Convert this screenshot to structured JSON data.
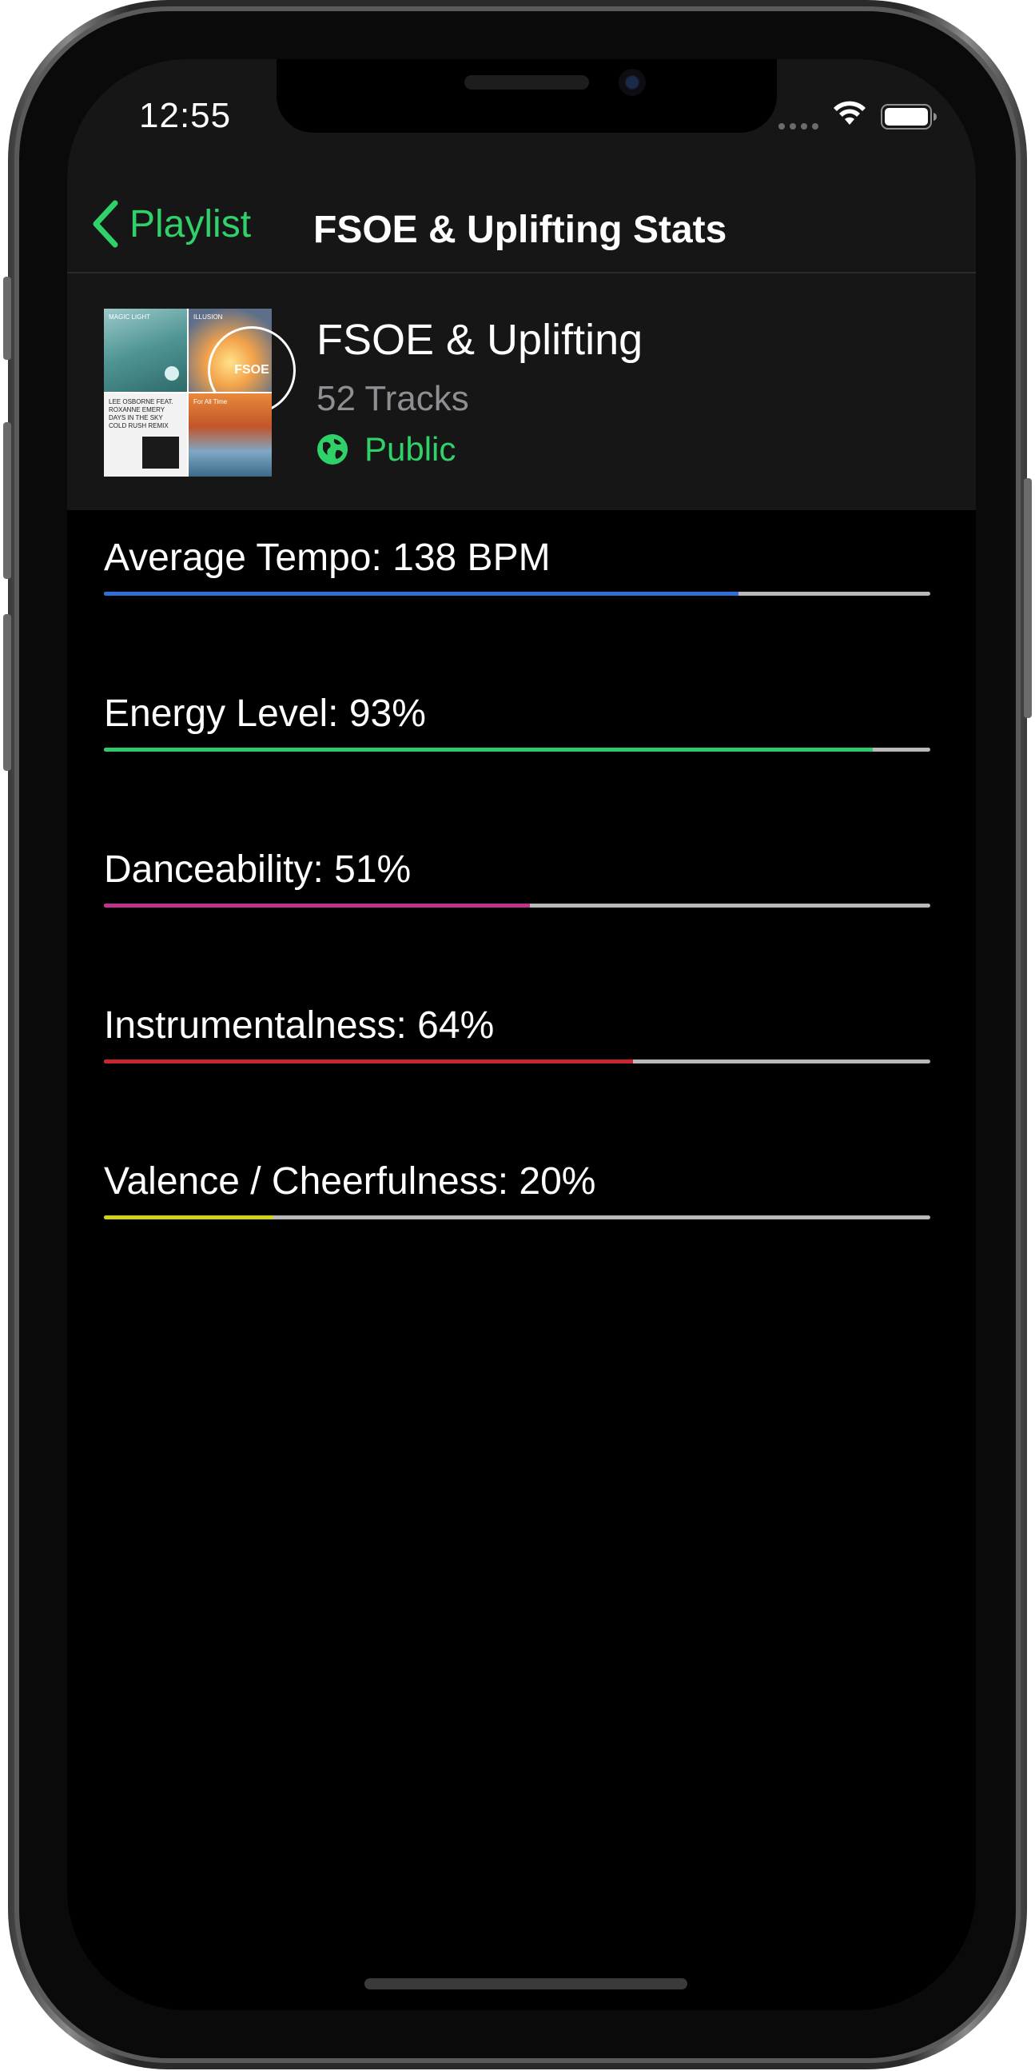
{
  "status_bar": {
    "time": "12:55"
  },
  "nav": {
    "back_label": "Playlist",
    "title": "FSOE & Uplifting Stats"
  },
  "playlist": {
    "name": "FSOE & Uplifting",
    "track_count": "52 Tracks",
    "visibility": "Public",
    "artwork": [
      {
        "label": "MAGIC LIGHT"
      },
      {
        "label": "ILLUSION"
      },
      {
        "label": "LEE OSBORNE FEAT. ROXANNE EMERY\nDAYS IN THE SKY\nCOLD RUSH REMIX"
      },
      {
        "label": "For All Time"
      }
    ]
  },
  "stats": [
    {
      "label": "Average Tempo: 138 BPM",
      "fraction": 0.768,
      "color": "#2f6fd6"
    },
    {
      "label": "Energy Level: 93%",
      "fraction": 0.93,
      "color": "#2fc96b"
    },
    {
      "label": "Danceability: 51%",
      "fraction": 0.515,
      "color": "#c0338a"
    },
    {
      "label": "Instrumentalness: 64%",
      "fraction": 0.64,
      "color": "#c8262b"
    },
    {
      "label": "Valence / Cheerfulness: 20%",
      "fraction": 0.205,
      "color": "#d2d21d"
    }
  ],
  "colors": {
    "accent": "#2fd168",
    "background": "#000000",
    "header_background": "#161616",
    "track": "#b9b9b9"
  }
}
